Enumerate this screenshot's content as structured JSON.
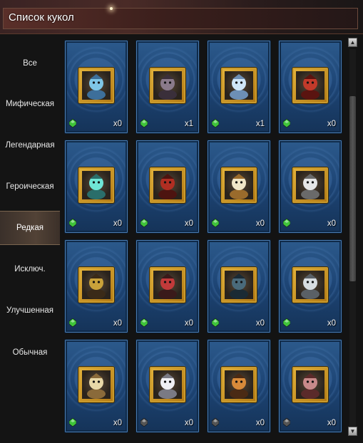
{
  "window": {
    "title": "Список кукол"
  },
  "categories": [
    {
      "label": "Все",
      "active": false
    },
    {
      "label": "Мифическая",
      "active": false
    },
    {
      "label": "Легендарная",
      "active": false
    },
    {
      "label": "Героическая",
      "active": false
    },
    {
      "label": "Редкая",
      "active": true
    },
    {
      "label": "Исключ.",
      "active": false
    },
    {
      "label": "Улучшенная",
      "active": false
    },
    {
      "label": "Обычная",
      "active": false
    }
  ],
  "cards": [
    {
      "count": "x0",
      "icon": "ice-beast-icon",
      "gem_color": "#3fc43a"
    },
    {
      "count": "x1",
      "icon": "stone-golem-icon",
      "gem_color": "#3fc43a"
    },
    {
      "count": "x1",
      "icon": "ice-spirit-icon",
      "gem_color": "#3fc43a"
    },
    {
      "count": "x0",
      "icon": "red-demon-icon",
      "gem_color": "#3fc43a"
    },
    {
      "count": "x0",
      "icon": "crystal-orb-icon",
      "gem_color": "#3fc43a"
    },
    {
      "count": "x0",
      "icon": "red-bear-icon",
      "gem_color": "#3fc43a"
    },
    {
      "count": "x0",
      "icon": "sage-monk-icon",
      "gem_color": "#3fc43a"
    },
    {
      "count": "x0",
      "icon": "white-bishop-icon",
      "gem_color": "#3fc43a"
    },
    {
      "count": "x0",
      "icon": "armored-knight-icon",
      "gem_color": "#3fc43a"
    },
    {
      "count": "x0",
      "icon": "crimson-mage-icon",
      "gem_color": "#3fc43a"
    },
    {
      "count": "x0",
      "icon": "dark-warrior-icon",
      "gem_color": "#3fc43a"
    },
    {
      "count": "x0",
      "icon": "pale-sorcerer-icon",
      "gem_color": "#3fc43a"
    },
    {
      "count": "x0",
      "icon": "golden-dragon-icon",
      "gem_color": "#3fc43a"
    },
    {
      "count": "x0",
      "icon": "silver-hair-girl-icon",
      "gem_color": "#555555"
    },
    {
      "count": "x0",
      "icon": "fox-rogue-icon",
      "gem_color": "#555555"
    },
    {
      "count": "x0",
      "icon": "pink-monkey-icon",
      "gem_color": "#555555"
    }
  ],
  "scroll": {
    "up_label": "▲",
    "down_label": "▼"
  }
}
